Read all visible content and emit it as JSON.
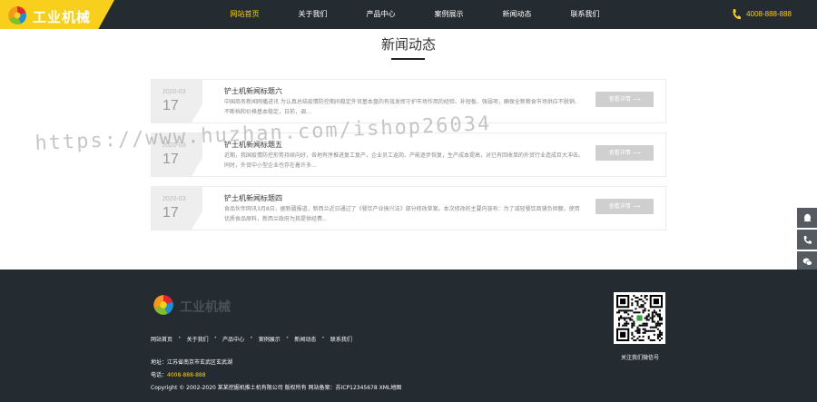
{
  "header": {
    "logo_text": "工业机械",
    "nav": [
      "网站首页",
      "关于我们",
      "产品中心",
      "案例展示",
      "新闻动态",
      "联系我们"
    ],
    "active_index": 0,
    "hotline": "4008-888-888",
    "colors": {
      "accent": "#f7cf1c",
      "bar": "#242b31"
    }
  },
  "section": {
    "title": "新闻动态"
  },
  "news": [
    {
      "date_ym": "2020-03",
      "date_d": "17",
      "title": "铲土机新闻标题六",
      "desc": "中国商务新闻网播进讯  为认真总结疫情防控期间稳定外贸基本盘的有效发挥守护市场作用的经验、补短板、强弱项，确保全新粮食市场供应不脱销、不断档和价格基本稳定，日前，调...",
      "more": "查看详情"
    },
    {
      "date_ym": "2020-03",
      "date_d": "17",
      "title": "铲土机新闻标题五",
      "desc": "近期，我国疫情防控形势持续向好，各地有序推进复工复产，企业员工返岗、产能逐步恢复，生产成本提高，对已有回收单的外贸行业造成巨大冲击。同时，外贸中小型企业也存在着许多...",
      "more": "查看详情"
    },
    {
      "date_ym": "2020-03",
      "date_d": "17",
      "title": "铲土机新闻标题四",
      "desc": "食品伙伴网讯3月8日，据新疆报道，新西兰近日通过了《餐饮产业振兴法》部分修改草案。本次修改的主要内容有：为了减轻餐饮商铺负担额，使用优质食品原料，新西兰政府为其提供经费...",
      "more": "查看详情"
    }
  ],
  "watermark": "https://www.huzhan.com/ishop26034",
  "side_bar": [
    "qq-icon",
    "phone-icon",
    "wechat-icon",
    "back-to-top-icon"
  ],
  "footer": {
    "logo_text": "工业机械",
    "nav": [
      "网站首页",
      "关于我们",
      "产品中心",
      "案例展示",
      "新闻动态",
      "联系我们"
    ],
    "address_label": "地址：",
    "address": "江苏省南京市玄武区玄武湖",
    "phone_label": "电话：",
    "phone": "4008-888-888",
    "copyright": "Copyright © 2002-2020 某某挖掘机推土机有限公司 版权所有  网站备案：苏ICP12345678 XML地图",
    "qr_caption": "关注我们微信号"
  }
}
